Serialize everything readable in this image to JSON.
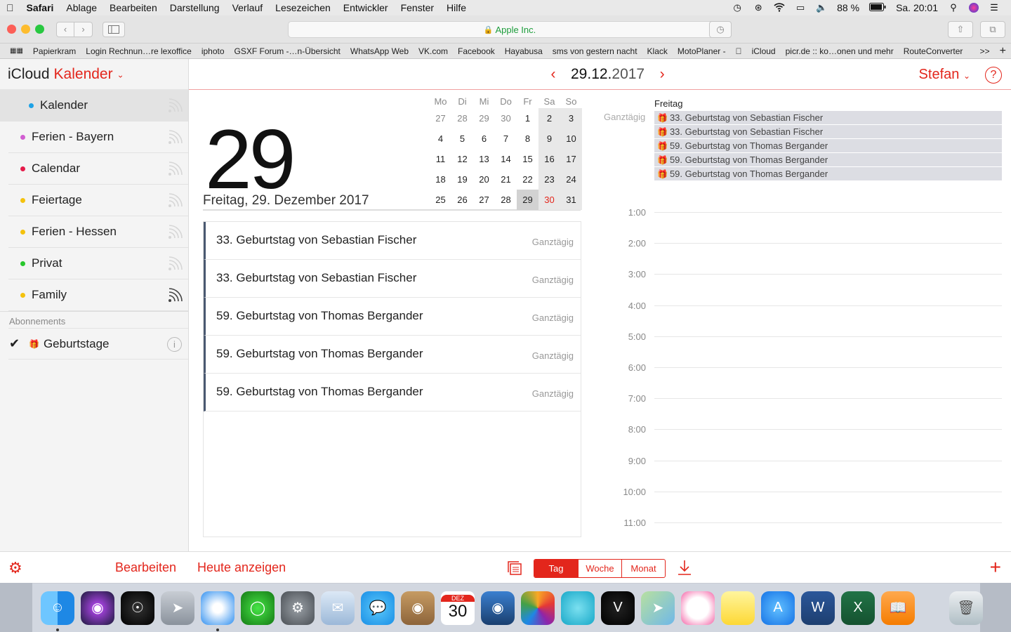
{
  "menubar": {
    "app": "Safari",
    "items": [
      "Ablage",
      "Bearbeiten",
      "Darstellung",
      "Verlauf",
      "Lesezeichen",
      "Entwickler",
      "Fenster",
      "Hilfe"
    ],
    "battery": "88 %",
    "clock": "Sa. 20:01"
  },
  "browser": {
    "url": "Apple Inc.",
    "favorites": [
      "Papierkram",
      "Login Rechnun…re lexoffice",
      "iphoto",
      "GSXF Forum -…n-Übersicht",
      "WhatsApp Web",
      "VK.com",
      "Facebook",
      "Hayabusa",
      "sms von gestern nacht",
      "Klack",
      "MotoPlaner -",
      "",
      "iCloud",
      "picr.de :: ko…onen und mehr",
      "RouteConverter"
    ],
    "more": ">>"
  },
  "sidebar": {
    "brand": "iCloud",
    "app": "Kalender",
    "calendars": [
      {
        "label": "Kalender",
        "color": "#1ea2e6"
      },
      {
        "label": "Ferien - Bayern",
        "color": "#d15ed1"
      },
      {
        "label": "Calendar",
        "color": "#e51b4a"
      },
      {
        "label": "Feiertage",
        "color": "#f4c20d"
      },
      {
        "label": "Ferien - Hessen",
        "color": "#f4c20d"
      },
      {
        "label": "Privat",
        "color": "#28c72c"
      },
      {
        "label": "Family",
        "color": "#f4c20d"
      }
    ],
    "section": "Abonnements",
    "subscription": "Geburtstage"
  },
  "header": {
    "date_day": "29.12.",
    "date_year": "2017",
    "user": "Stefan",
    "help": "?"
  },
  "day": {
    "number": "29",
    "long": "Freitag, 29. Dezember 2017"
  },
  "mini_month": {
    "weekdays": [
      "Mo",
      "Di",
      "Mi",
      "Do",
      "Fr",
      "Sa",
      "So"
    ],
    "weeks": [
      [
        "27",
        "28",
        "29",
        "30",
        "1",
        "2",
        "3"
      ],
      [
        "4",
        "5",
        "6",
        "7",
        "8",
        "9",
        "10"
      ],
      [
        "11",
        "12",
        "13",
        "14",
        "15",
        "16",
        "17"
      ],
      [
        "18",
        "19",
        "20",
        "21",
        "22",
        "23",
        "24"
      ],
      [
        "25",
        "26",
        "27",
        "28",
        "29",
        "30",
        "31"
      ]
    ]
  },
  "events": [
    {
      "title": "33. Geburtstag von Sebastian Fischer",
      "when": "Ganztägig"
    },
    {
      "title": "33. Geburtstag von Sebastian Fischer",
      "when": "Ganztägig"
    },
    {
      "title": "59. Geburtstag von Thomas Bergander",
      "when": "Ganztägig"
    },
    {
      "title": "59. Geburtstag von Thomas Bergander",
      "when": "Ganztägig"
    },
    {
      "title": "59. Geburtstag von Thomas Bergander",
      "when": "Ganztägig"
    }
  ],
  "dayview": {
    "weekday": "Freitag",
    "allday_label": "Ganztägig",
    "hours": [
      "1:00",
      "2:00",
      "3:00",
      "4:00",
      "5:00",
      "6:00",
      "7:00",
      "8:00",
      "9:00",
      "10:00",
      "11:00"
    ]
  },
  "bottombar": {
    "edit": "Bearbeiten",
    "today": "Heute anzeigen",
    "views": [
      "Tag",
      "Woche",
      "Monat"
    ],
    "active_view": "Tag"
  },
  "dock": {
    "calendar_month": "DEZ",
    "calendar_day": "30",
    "apps": [
      "finder-icon",
      "siri-icon",
      "dashboard-icon",
      "launchpad-icon",
      "safari-icon",
      "vpn-globe-icon",
      "system-preferences-icon",
      "mail-icon",
      "messages-icon",
      "contacts-icon",
      "calendar-icon",
      "photo-booth-icon",
      "photos-icon",
      "app-icon",
      "vivaldi-icon",
      "maps-icon",
      "itunes-icon",
      "notes-icon",
      "app-store-icon",
      "word-icon",
      "excel-icon",
      "books-icon",
      "trash-icon"
    ]
  },
  "colors": {
    "accent": "#e3261c",
    "event_bar": "#4a5870",
    "allday_bg": "#dcdde3"
  }
}
